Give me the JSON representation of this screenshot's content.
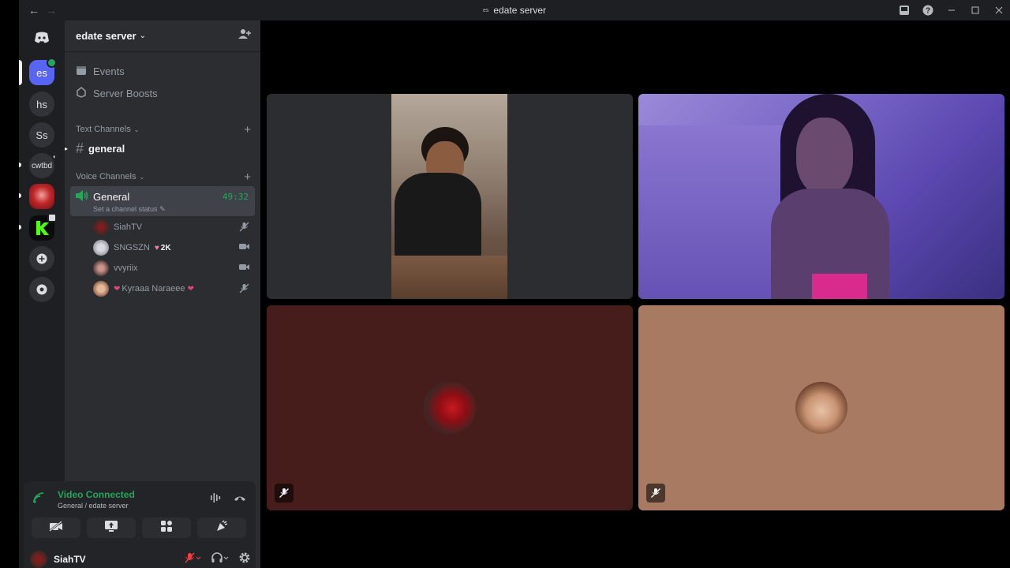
{
  "window": {
    "title": "edate server",
    "title_badge": "es"
  },
  "guilds": {
    "items": [
      {
        "label": "es",
        "selected": true
      },
      {
        "label": "hs"
      },
      {
        "label": "Ss"
      },
      {
        "label": "cwtbd"
      }
    ]
  },
  "server": {
    "name": "edate server",
    "menu": [
      {
        "label": "Events",
        "icon": "calendar-icon"
      },
      {
        "label": "Server Boosts",
        "icon": "boost-icon"
      }
    ]
  },
  "text_category": {
    "label": "Text Channels"
  },
  "text_channels": [
    {
      "name": "general"
    }
  ],
  "voice_category": {
    "label": "Voice Channels"
  },
  "voice_channel": {
    "name": "General",
    "timer": "49:32",
    "status": "Set a channel status",
    "users": [
      {
        "name": "SiahTV",
        "icon": "mic-muted-icon"
      },
      {
        "name": "SNGSZN",
        "badge": "2K",
        "icon": "video-icon"
      },
      {
        "name": "vvyriix",
        "icon": "video-icon"
      },
      {
        "name": "Kyraaa Naraeee",
        "icon": "mic-muted-icon"
      }
    ]
  },
  "voice_panel": {
    "title": "Video Connected",
    "subtitle": "General / edate server"
  },
  "user": {
    "name": "SiahTV"
  },
  "colors": {
    "accent_green": "#23a55a",
    "blurple": "#5865f2",
    "tile_dark_red": "#461d1a",
    "tile_tan": "#a97a62"
  }
}
